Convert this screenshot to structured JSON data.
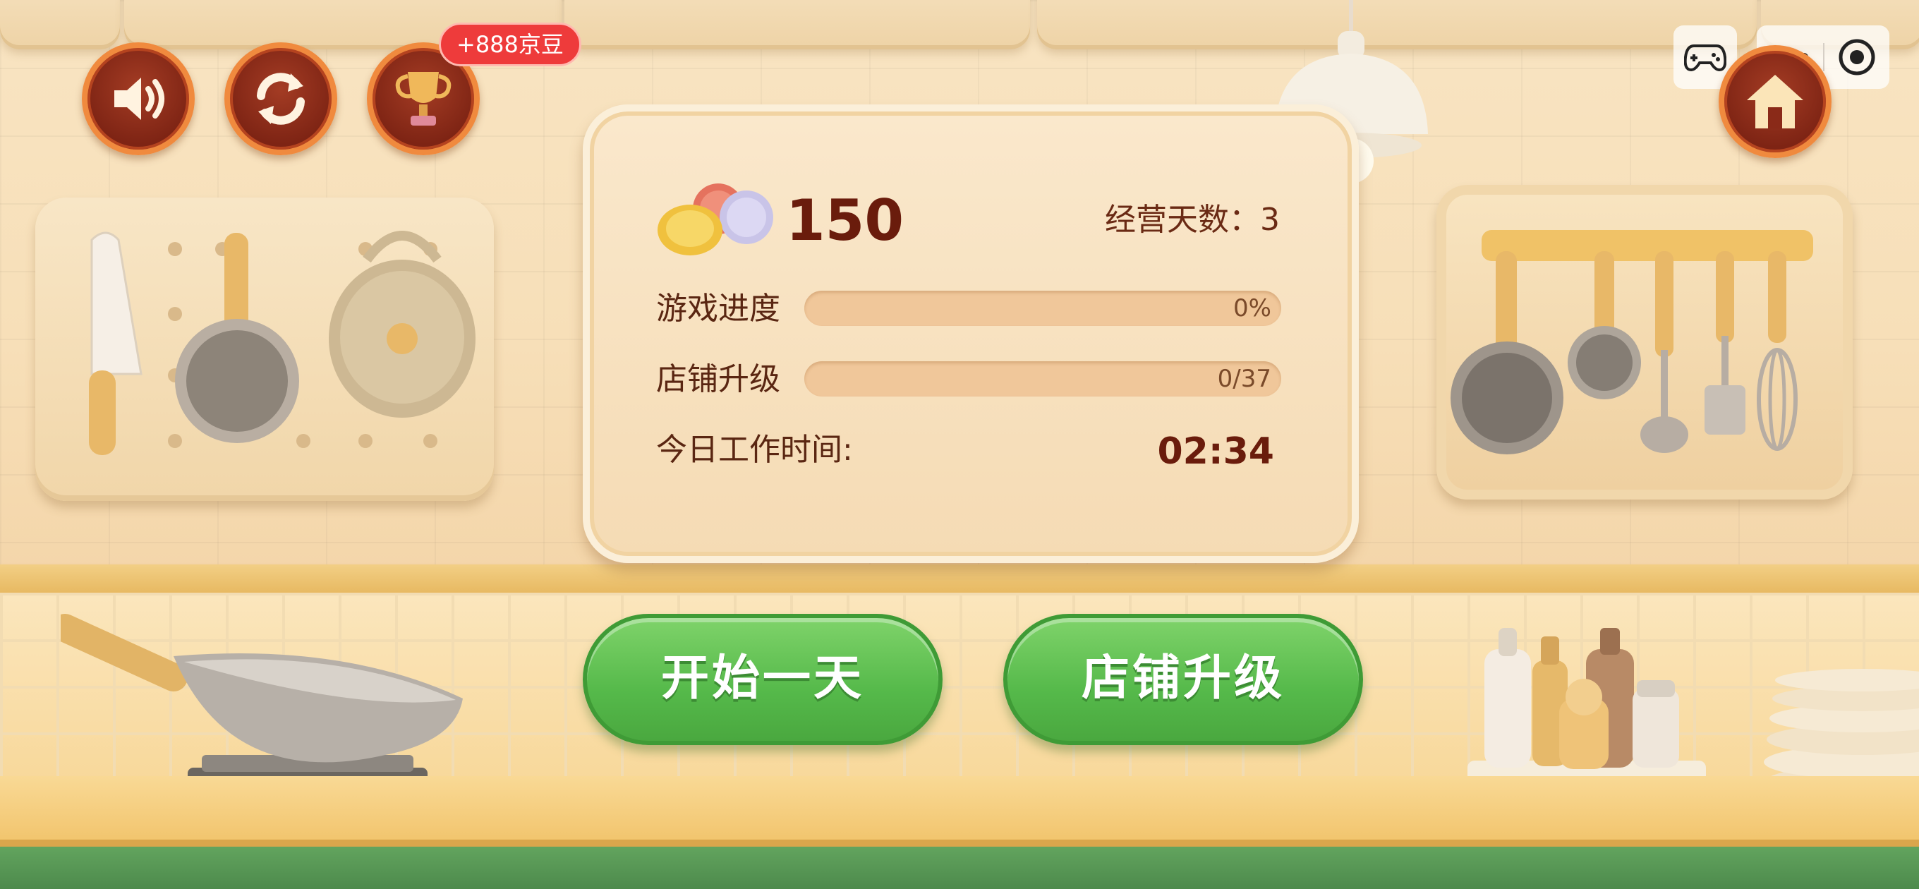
{
  "badge": {
    "text": "+888京豆"
  },
  "stats": {
    "coins": "150",
    "days_text": "经营天数：3",
    "progress_label": "游戏进度",
    "progress_value": 0,
    "progress_text": "0%",
    "upgrade_label": "店铺升级",
    "upgrade_value": 0,
    "upgrade_text": "0/37",
    "work_time_label": "今日工作时间:",
    "work_time": "02:34"
  },
  "buttons": {
    "start_day": "开始一天",
    "shop_upgrade": "店铺升级"
  },
  "icons": {
    "sound": "speaker-icon",
    "refresh": "refresh-icon",
    "trophy": "trophy-icon",
    "home": "home-icon",
    "gamepad": "gamepad-icon",
    "more": "more-dots-icon",
    "close": "capsule-close-icon"
  },
  "colors": {
    "accent_green": "#55b94a",
    "badge_red": "#ee3b3b",
    "text_dark_red": "#6a1c0c",
    "round_btn": "#8a2a18"
  }
}
